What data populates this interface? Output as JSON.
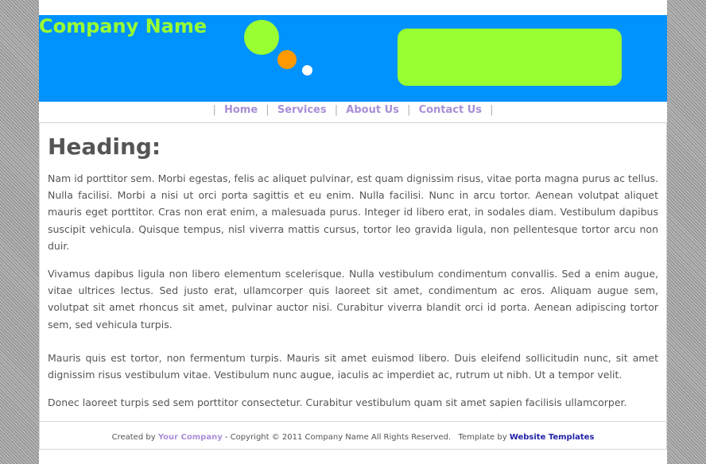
{
  "header": {
    "company_name": "Company Name"
  },
  "nav": {
    "separator": "|",
    "items": [
      {
        "label": "Home"
      },
      {
        "label": "Services"
      },
      {
        "label": "About Us"
      },
      {
        "label": "Contact Us"
      }
    ]
  },
  "content": {
    "heading": "Heading:",
    "paragraphs": [
      "Nam id porttitor sem. Morbi egestas, felis ac aliquet pulvinar, est quam dignissim risus, vitae porta magna purus ac tellus. Nulla facilisi. Morbi a nisi ut orci porta sagittis et eu enim. Nulla facilisi. Nunc in arcu tortor. Aenean volutpat aliquet mauris eget porttitor. Cras non erat enim, a malesuada purus. Integer id libero erat, in sodales diam. Vestibulum dapibus suscipit vehicula. Quisque tempus, nisl viverra mattis cursus, tortor leo gravida ligula, non pellentesque tortor arcu non duir.",
      "Vivamus dapibus ligula non libero elementum scelerisque. Nulla vestibulum condimentum convallis. Sed a enim augue, vitae ultrices lectus. Sed justo erat, ullamcorper quis laoreet sit amet, condimentum ac eros. Aliquam augue sem, volutpat sit amet rhoncus sit amet, pulvinar auctor nisi. Curabitur viverra blandit orci id porta. Aenean adipiscing tortor sem, sed vehicula turpis.",
      "Mauris quis est tortor, non fermentum turpis. Mauris sit amet euismod libero. Duis eleifend sollicitudin nunc, sit amet dignissim risus vestibulum vitae. Vestibulum nunc augue, iaculis ac imperdiet ac, rutrum ut nibh. Ut a tempor velit.",
      "Donec laoreet turpis sed sem porttitor consectetur. Curabitur vestibulum quam sit amet sapien facilisis ullamcorper."
    ]
  },
  "footer": {
    "created_by": "Created by",
    "company_link": "Your Company",
    "copyright": "- Copyright © 2011 Company Name All Rights Reserved.",
    "template_by": "Template by",
    "templates_link": "Website Templates"
  },
  "colors": {
    "header_bg": "#0092ff",
    "accent_green": "#99ff33",
    "accent_orange": "#ff9900",
    "nav_link": "#a98ed6",
    "text": "#555555"
  }
}
